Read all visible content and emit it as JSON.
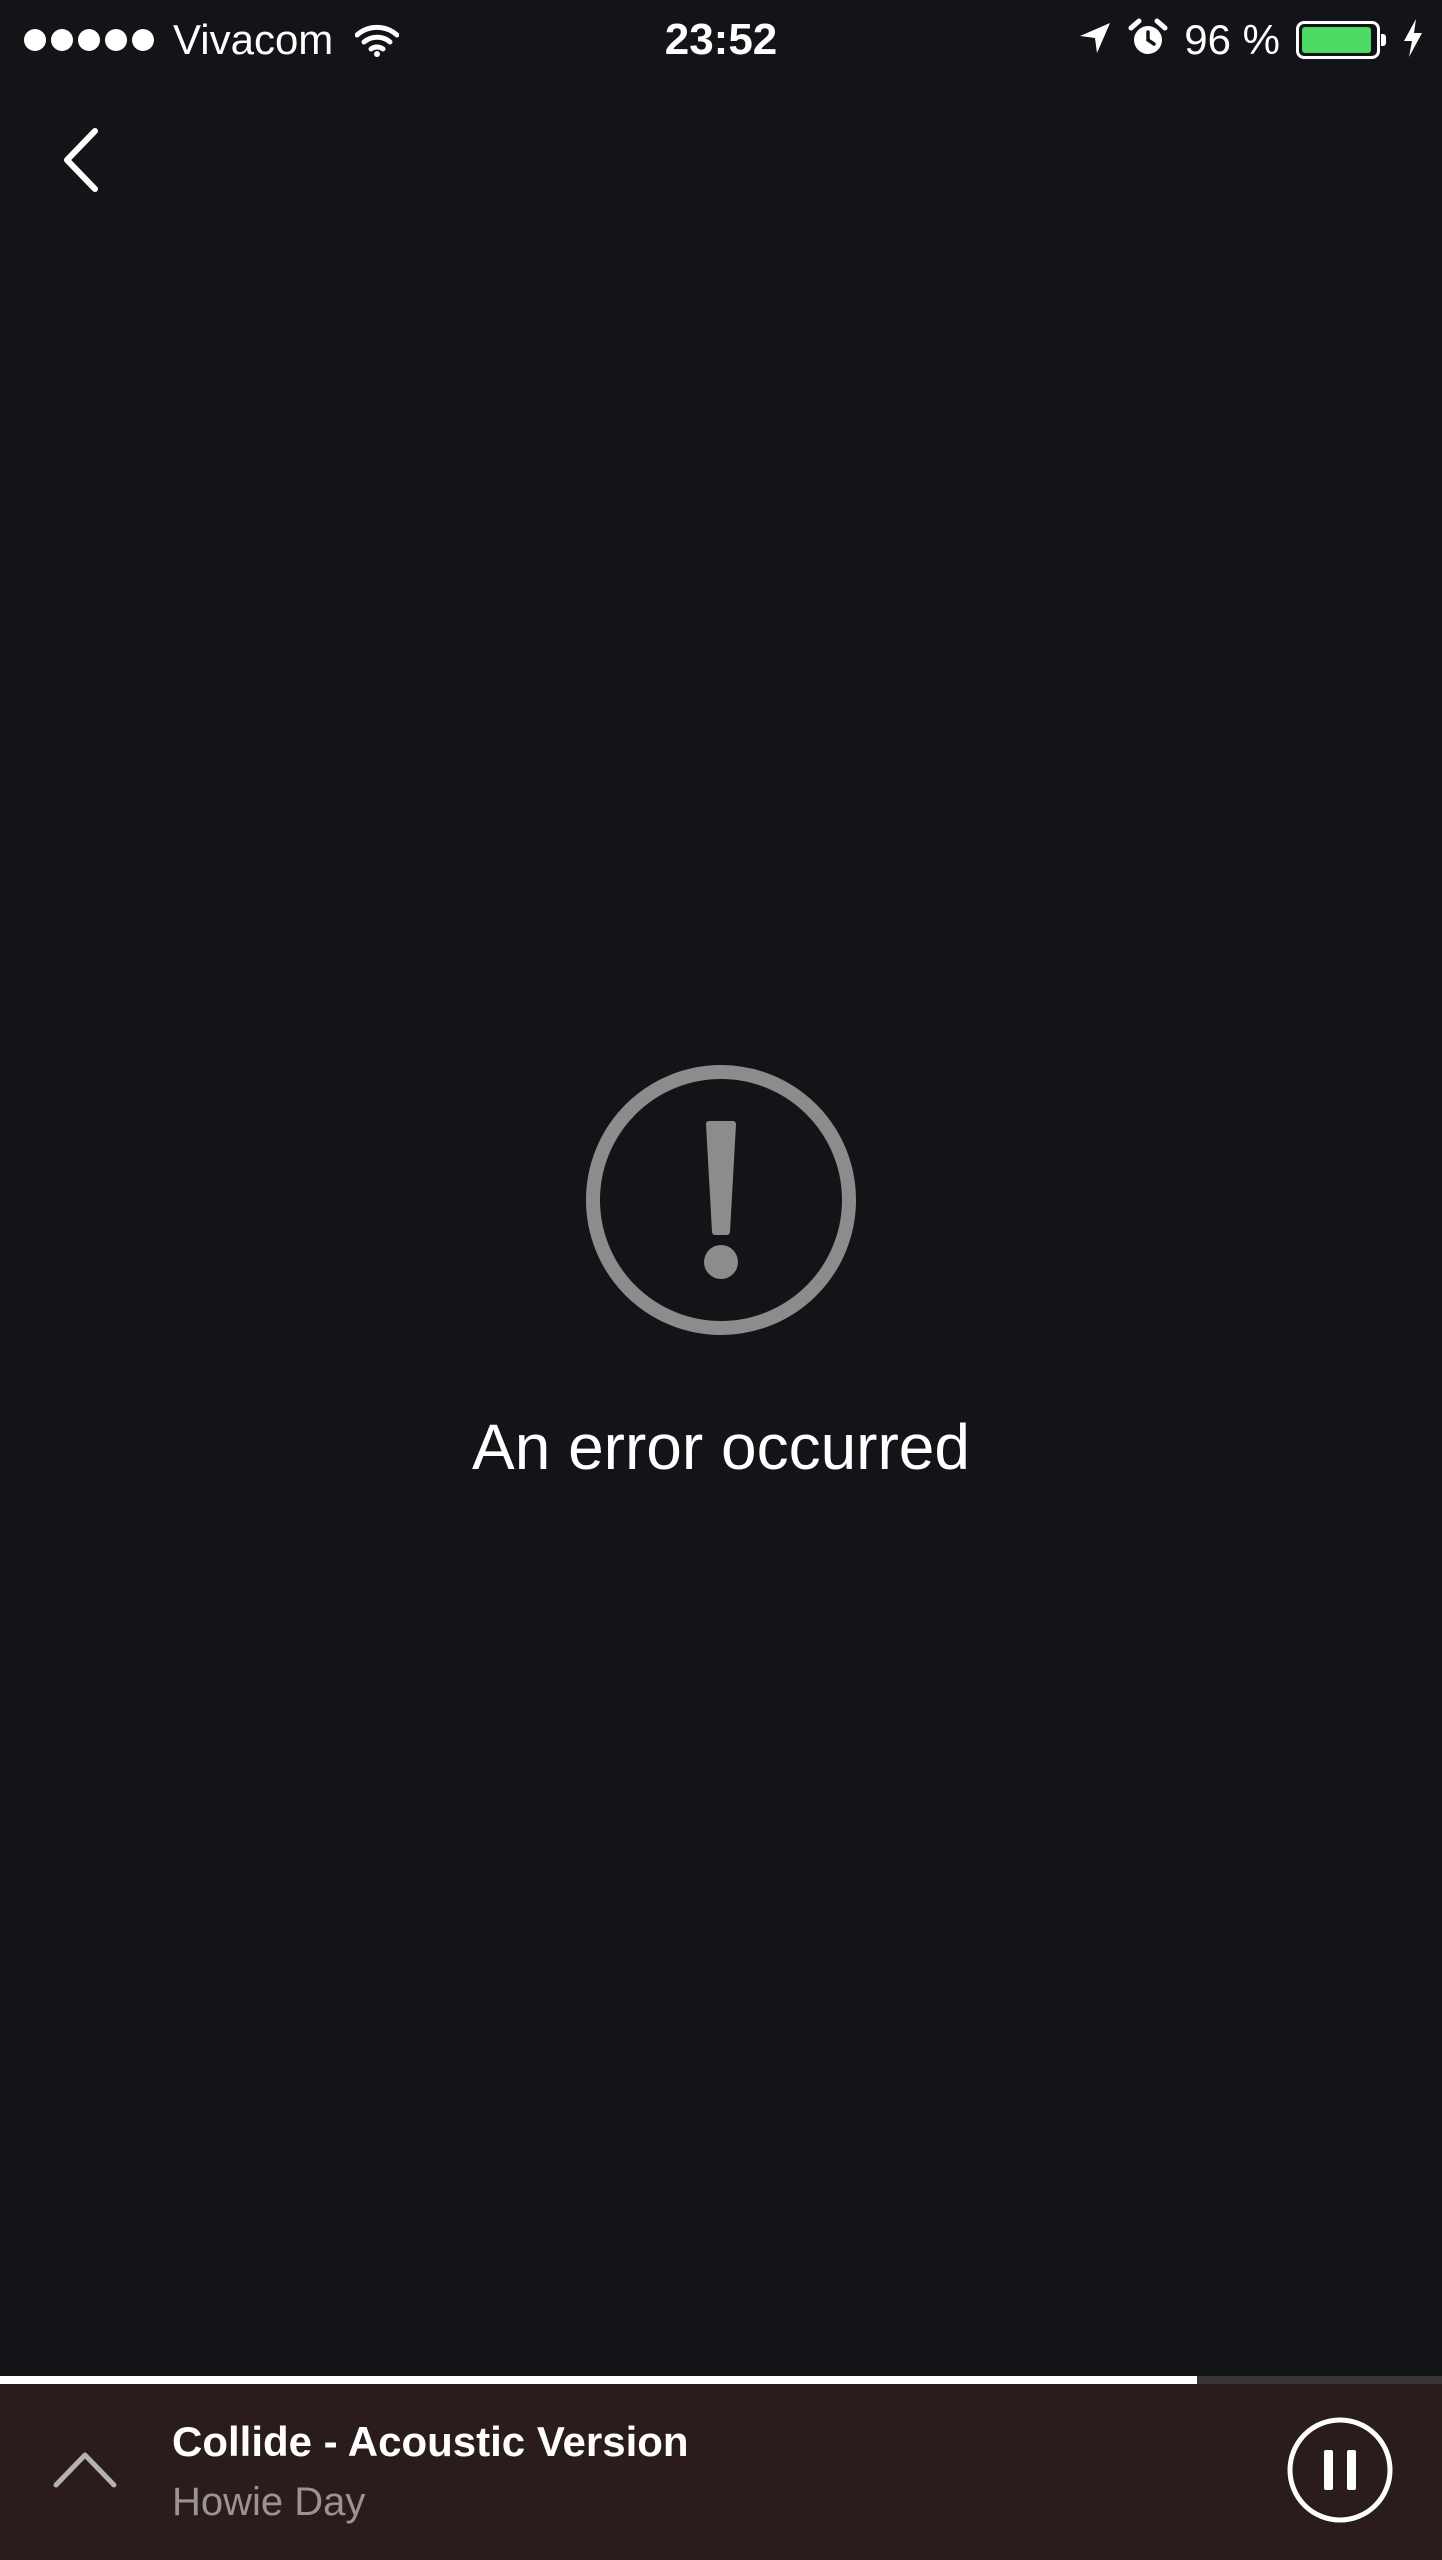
{
  "status_bar": {
    "carrier": "Vivacom",
    "time": "23:52",
    "battery_percent": "96 %",
    "battery_level": 0.96,
    "icons": [
      "signal-dots",
      "wifi-icon",
      "location-arrow-icon",
      "alarm-clock-icon",
      "battery-icon",
      "charging-bolt-icon"
    ]
  },
  "nav": {
    "back_icon": "chevron-left-icon"
  },
  "error": {
    "icon": "exclamation-circle-icon",
    "message": "An error occurred"
  },
  "now_playing": {
    "title": "Collide - Acoustic Version",
    "artist": "Howie Day",
    "progress": 0.83,
    "expand_icon": "chevron-up-icon",
    "control_icon": "pause-circle-icon"
  },
  "colors": {
    "background": "#131417",
    "now_playing_bg": "#2a1c1a",
    "battery_green": "#4cd964",
    "icon_gray": "#8c8c8c",
    "artist_gray": "#9b9391"
  }
}
